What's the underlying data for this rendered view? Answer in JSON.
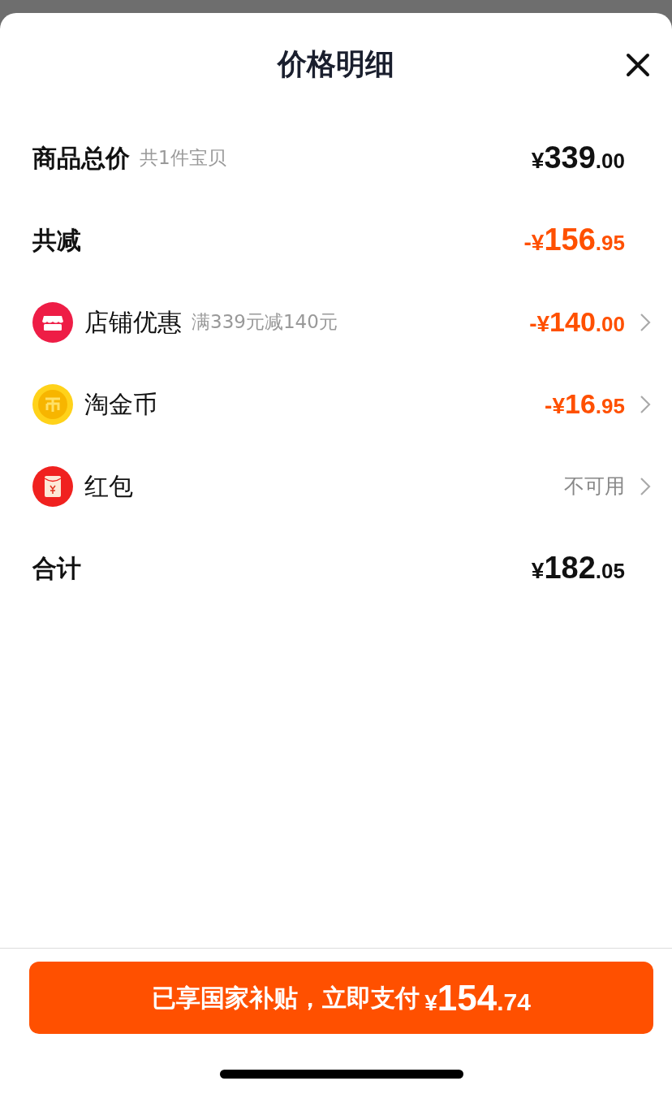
{
  "sheet": {
    "title": "价格明细"
  },
  "rows": [
    {
      "kind": "total",
      "label": "商品总价",
      "note": "共1件宝贝",
      "amount": "¥339.00",
      "chevron": false
    },
    {
      "kind": "reduction",
      "label": "共减",
      "amount": "-¥156.95",
      "chevron": false
    },
    {
      "kind": "shop",
      "label": "店铺优惠",
      "note": "满339元减140元",
      "amount": "-¥140.00",
      "chevron": true
    },
    {
      "kind": "coin",
      "label": "淘金币",
      "amount": "-¥16.95",
      "chevron": true
    },
    {
      "kind": "redpacket",
      "label": "红包",
      "status": "不可用",
      "chevron": true
    },
    {
      "kind": "sum",
      "label": "合计",
      "amount": "¥182.05",
      "chevron": false
    }
  ],
  "pay_button": {
    "label": "已享国家补贴，立即支付",
    "amount": "¥154.74"
  }
}
